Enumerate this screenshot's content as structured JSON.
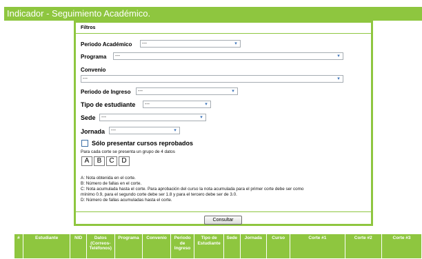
{
  "title": "Indicador - Seguimiento Académico.",
  "filters": {
    "header": "Filtros",
    "periodo_academico": {
      "label": "Periodo Académico",
      "value": "---"
    },
    "programa": {
      "label": "Programa",
      "value": "---"
    },
    "convenio": {
      "label": "Convenio",
      "value": "---"
    },
    "periodo_ingreso": {
      "label": "Periodo de Ingreso",
      "value": "---"
    },
    "tipo_estudiante": {
      "label": "Tipo de estudiante",
      "value": "---"
    },
    "sede": {
      "label": "Sede",
      "value": "---"
    },
    "jornada": {
      "label": "Jornada",
      "value": "---"
    },
    "reprobados": {
      "label": "Sólo presentar cursos reprobados",
      "checked": false
    },
    "group_note": "Para cada corte se presenta un grupo de 4 datos",
    "group_letters": [
      "A",
      "B",
      "C",
      "D"
    ],
    "legend": [
      "A: Nota obtenida en el corte.",
      "B: Número de fallas en el corte.",
      "C: Nota acumulada hasta el corte. Para aprobación del curso la nota acumulada para el primer corte debe ser como",
      "mínimo 0.9, para el segundo corte debe ser 1.8 y para el tercero debe ser de 3.0.",
      "D: Número de fallas acumuladas hasta el corte."
    ],
    "consultar_label": "Consultar"
  },
  "table": {
    "columns": [
      {
        "key": "num",
        "l1": "#",
        "l2": "",
        "l3": "",
        "l4": ""
      },
      {
        "key": "estudiante",
        "l1": "Estudiante",
        "l2": "",
        "l3": "",
        "l4": ""
      },
      {
        "key": "nid",
        "l1": "NID",
        "l2": "",
        "l3": "",
        "l4": ""
      },
      {
        "key": "datos",
        "l1": "Datos",
        "l2": "(Correos-",
        "l3": "Teléfonos)",
        "l4": ""
      },
      {
        "key": "programa",
        "l1": "Programa",
        "l2": "",
        "l3": "",
        "l4": ""
      },
      {
        "key": "convenio",
        "l1": "Convenio",
        "l2": "",
        "l3": "",
        "l4": ""
      },
      {
        "key": "periodo",
        "l1": "Periodo",
        "l2": "de",
        "l3": "Ingreso",
        "l4": ""
      },
      {
        "key": "tipo",
        "l1": "Tipo de",
        "l2": "Estudiante",
        "l3": "",
        "l4": ""
      },
      {
        "key": "sede",
        "l1": "Sede",
        "l2": "",
        "l3": "",
        "l4": ""
      },
      {
        "key": "jornada",
        "l1": "Jornada",
        "l2": "",
        "l3": "",
        "l4": ""
      },
      {
        "key": "curso",
        "l1": "Curso",
        "l2": "",
        "l3": "",
        "l4": ""
      },
      {
        "key": "corte1",
        "l1": "Corte #1",
        "l2": "",
        "l3": "",
        "l4": ""
      },
      {
        "key": "corte2",
        "l1": "Corte #2",
        "l2": "",
        "l3": "",
        "l4": ""
      },
      {
        "key": "corte3",
        "l1": "Corte #3",
        "l2": "",
        "l3": "",
        "l4": ""
      }
    ]
  },
  "colors": {
    "accent": "#8ec63f",
    "dropdown_arrow": "#3b73b9"
  },
  "icons": {
    "dropdown": "chevron-down-icon",
    "checkbox": "checkbox-icon"
  }
}
